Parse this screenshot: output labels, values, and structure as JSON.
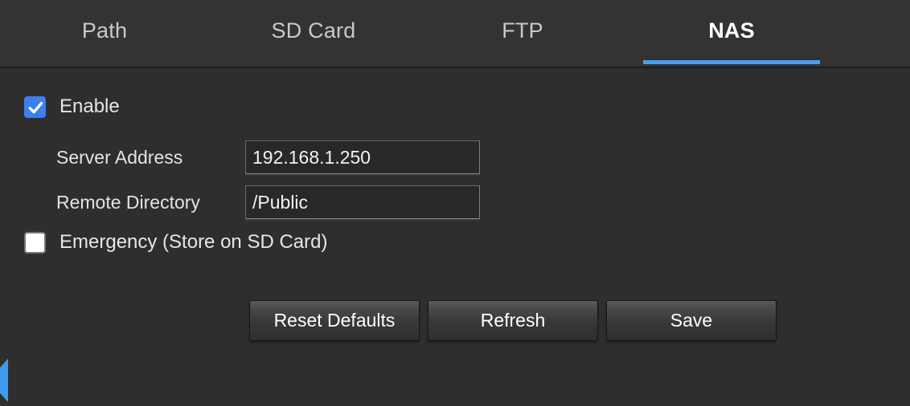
{
  "tabs": [
    {
      "id": "path",
      "label": "Path",
      "active": false
    },
    {
      "id": "sdcard",
      "label": "SD Card",
      "active": false
    },
    {
      "id": "ftp",
      "label": "FTP",
      "active": false
    },
    {
      "id": "nas",
      "label": "NAS",
      "active": true
    }
  ],
  "form": {
    "enable": {
      "label": "Enable",
      "checked": true
    },
    "server_address": {
      "label": "Server Address",
      "value": "192.168.1.250"
    },
    "remote_directory": {
      "label": "Remote Directory",
      "value": "/Public"
    },
    "emergency": {
      "label": "Emergency (Store on SD Card)",
      "checked": false
    }
  },
  "buttons": {
    "reset_defaults": "Reset Defaults",
    "refresh": "Refresh",
    "save": "Save"
  },
  "icons": {
    "checkmark": "check-icon",
    "edge_handle": "collapse-arrow-icon"
  },
  "colors": {
    "background": "#2e2e2e",
    "tabbar_background": "#333333",
    "active_tab_underline": "#4a9eee",
    "checkbox_checked": "#3b7ff0",
    "edge_handle": "#3f9bf0",
    "text_primary": "#ffffff",
    "text_secondary": "#c9c9c9"
  }
}
